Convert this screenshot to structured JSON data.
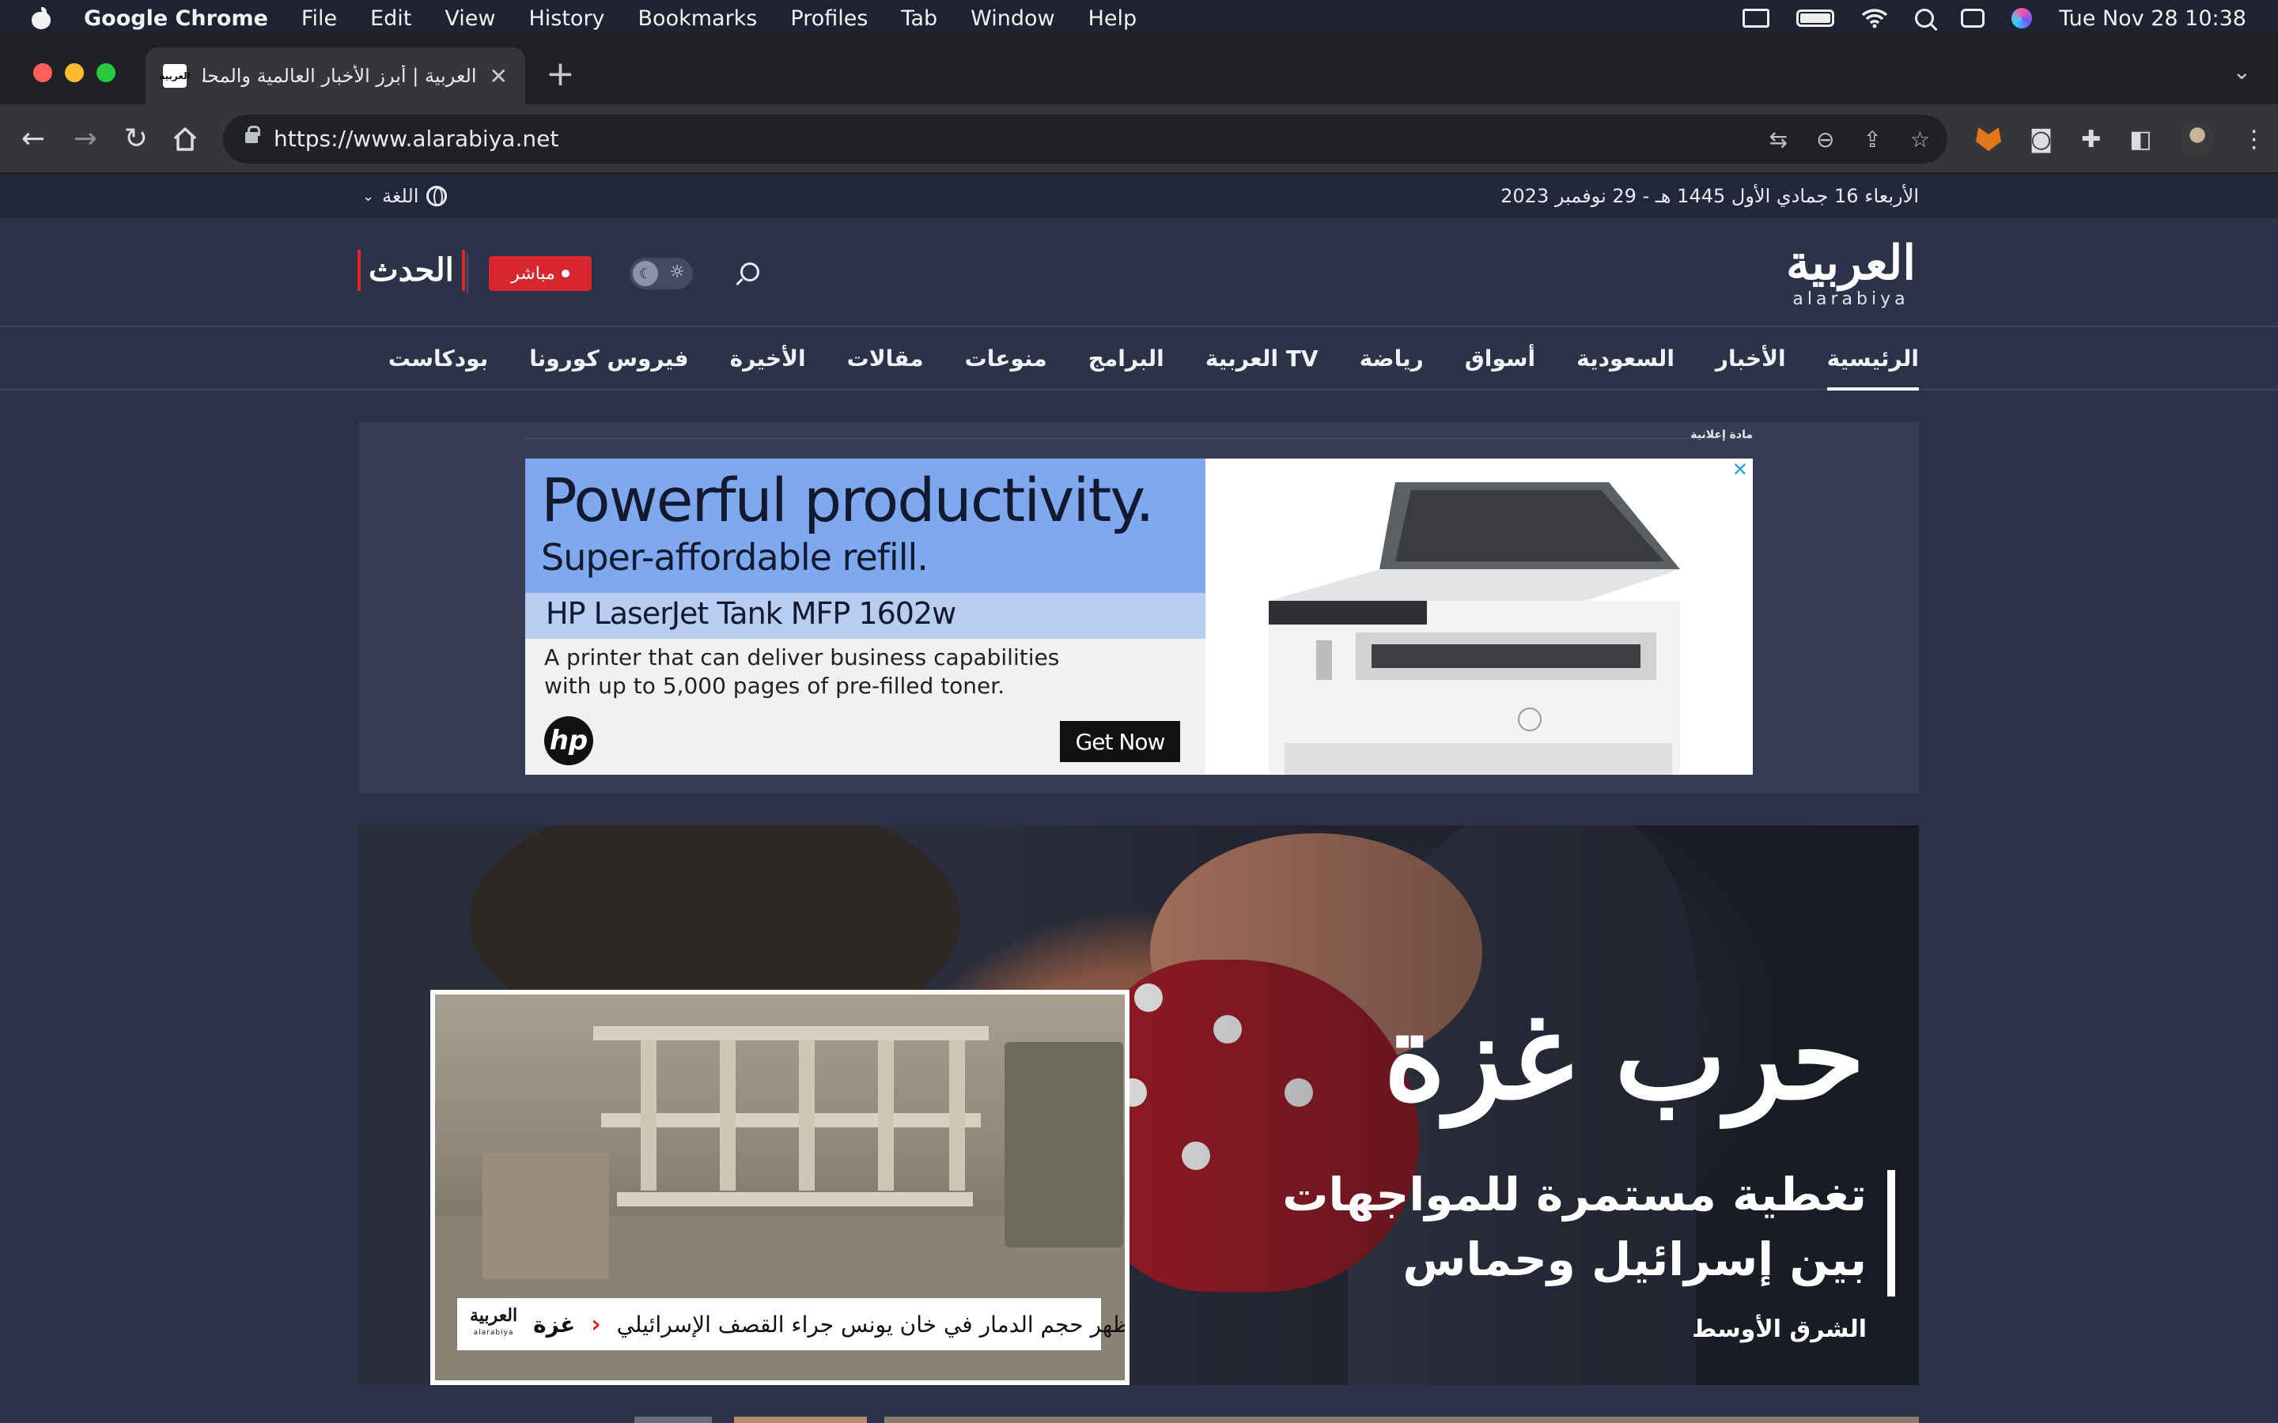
{
  "menubar": {
    "app": "Google Chrome",
    "items": [
      "File",
      "Edit",
      "View",
      "History",
      "Bookmarks",
      "Profiles",
      "Tab",
      "Window",
      "Help"
    ],
    "clock": "Tue Nov 28  10:38"
  },
  "browser": {
    "tab_title": "العربية | أبرز الأخبار العالمية والمحلية",
    "tab_favicon": "العربية",
    "url": "https://www.alarabiya.net"
  },
  "site": {
    "date_line": "الأربعاء 16 جمادي الأول 1445 هـ - 29 نوفمبر 2023",
    "language_label": "اللغة",
    "logo_ar": "العربية",
    "logo_en": "alarabiya",
    "live_label": "مباشر",
    "hadath_logo": "الحدث",
    "nav": [
      "الرئيسية",
      "الأخبار",
      "السعودية",
      "أسواق",
      "رياضة",
      "العربية TV",
      "البرامج",
      "منوعات",
      "مقالات",
      "الأخيرة",
      "فيروس كورونا",
      "بودكاست"
    ],
    "nav_active": 0
  },
  "ad": {
    "label": "مادة إعلانية",
    "headline": "Powerful productivity.",
    "subheadline": "Super-affordable refill.",
    "product": "HP LaserJet Tank MFP 1602w",
    "body": "A printer that can deliver business capabilities with up to 5,000 pages of pre-filled toner.",
    "brand": "hp",
    "cta": "Get Now",
    "close": "✕"
  },
  "hero": {
    "title": "حرب غزة",
    "subtitle": "تغطية مستمرة للمواجهات بين إسرائيل وحماس",
    "source": "الشرق الأوسط",
    "video": {
      "logo": "العربية",
      "logo_en": "alarabiya",
      "tag": "غزة",
      "chevron": "‹",
      "caption": "صور جوية تظهر حجم الدمار في خان يونس جراء القصف الإسرائيلي"
    }
  }
}
